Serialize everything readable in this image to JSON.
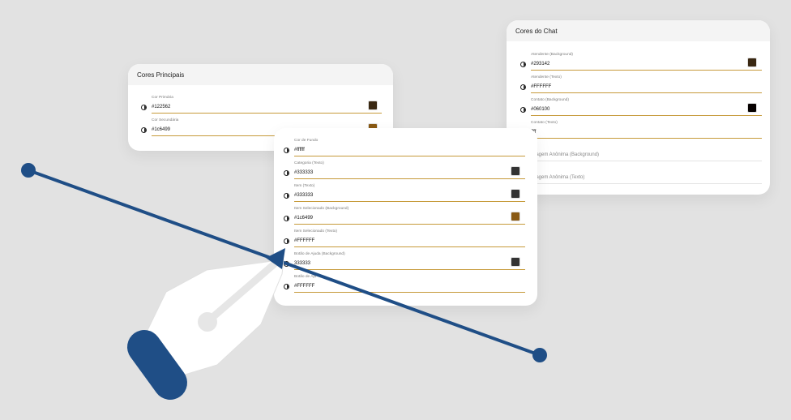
{
  "cores_principais": {
    "title": "Cores Principais",
    "fields": [
      {
        "label": "Cor Primária",
        "value": "#122562",
        "swatch": "#3a2812"
      },
      {
        "label": "Cor Secundária",
        "value": "#1c6499",
        "swatch": "#8a5a14"
      }
    ]
  },
  "cores_chat": {
    "title": "Cores do Chat",
    "fields": [
      {
        "label": "Atendente (Background)",
        "value": "#293142",
        "swatch": "#3a2812"
      },
      {
        "label": "Atendente (Texto)",
        "value": "#FFFFFF",
        "swatch": ""
      },
      {
        "label": "Contato (Background)",
        "value": "#060100",
        "swatch": "#060100"
      },
      {
        "label": "Contato (Texto)",
        "value": "ffff",
        "swatch": ""
      },
      {
        "label": "",
        "value": "nsagem Anônima (Background)",
        "swatch": ""
      },
      {
        "label": "",
        "value": "nsagem Anônima (Texto)",
        "swatch": ""
      }
    ]
  },
  "menu_cores": {
    "fields": [
      {
        "label": "Cor de Fundo",
        "value": "#ffffff",
        "swatch": ""
      },
      {
        "label": "Categoria (Texto)",
        "value": "#333333",
        "swatch": "#333333"
      },
      {
        "label": "Item (Texto)",
        "value": "#333333",
        "swatch": "#333333"
      },
      {
        "label": "Item Selecionado (Background)",
        "value": "#1c6499",
        "swatch": "#8a5a14"
      },
      {
        "label": "Item Selecionado (Texto)",
        "value": "#FFFFFF",
        "swatch": ""
      },
      {
        "label": "Botão de Ajuda (Background)",
        "value": "333333",
        "swatch": "#333333"
      },
      {
        "label": "Botão de Aju",
        "value": "#FFFFFF",
        "swatch": ""
      }
    ]
  },
  "colors": {
    "accent_line": "#c69a3a",
    "pen_blue": "#1f4e86",
    "background": "#e2e2e2"
  },
  "icons": {
    "field_icon": "contrast-icon",
    "decoration": "pen-tool-icon"
  }
}
